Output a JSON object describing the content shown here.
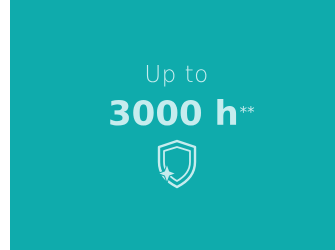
{
  "banner": {
    "line1": "Up to",
    "value": "3000 h",
    "footnote_mark": "**",
    "icon": "shield-sparkle-icon",
    "colors": {
      "background": "#0fabac",
      "text": "#c6ecee"
    }
  }
}
